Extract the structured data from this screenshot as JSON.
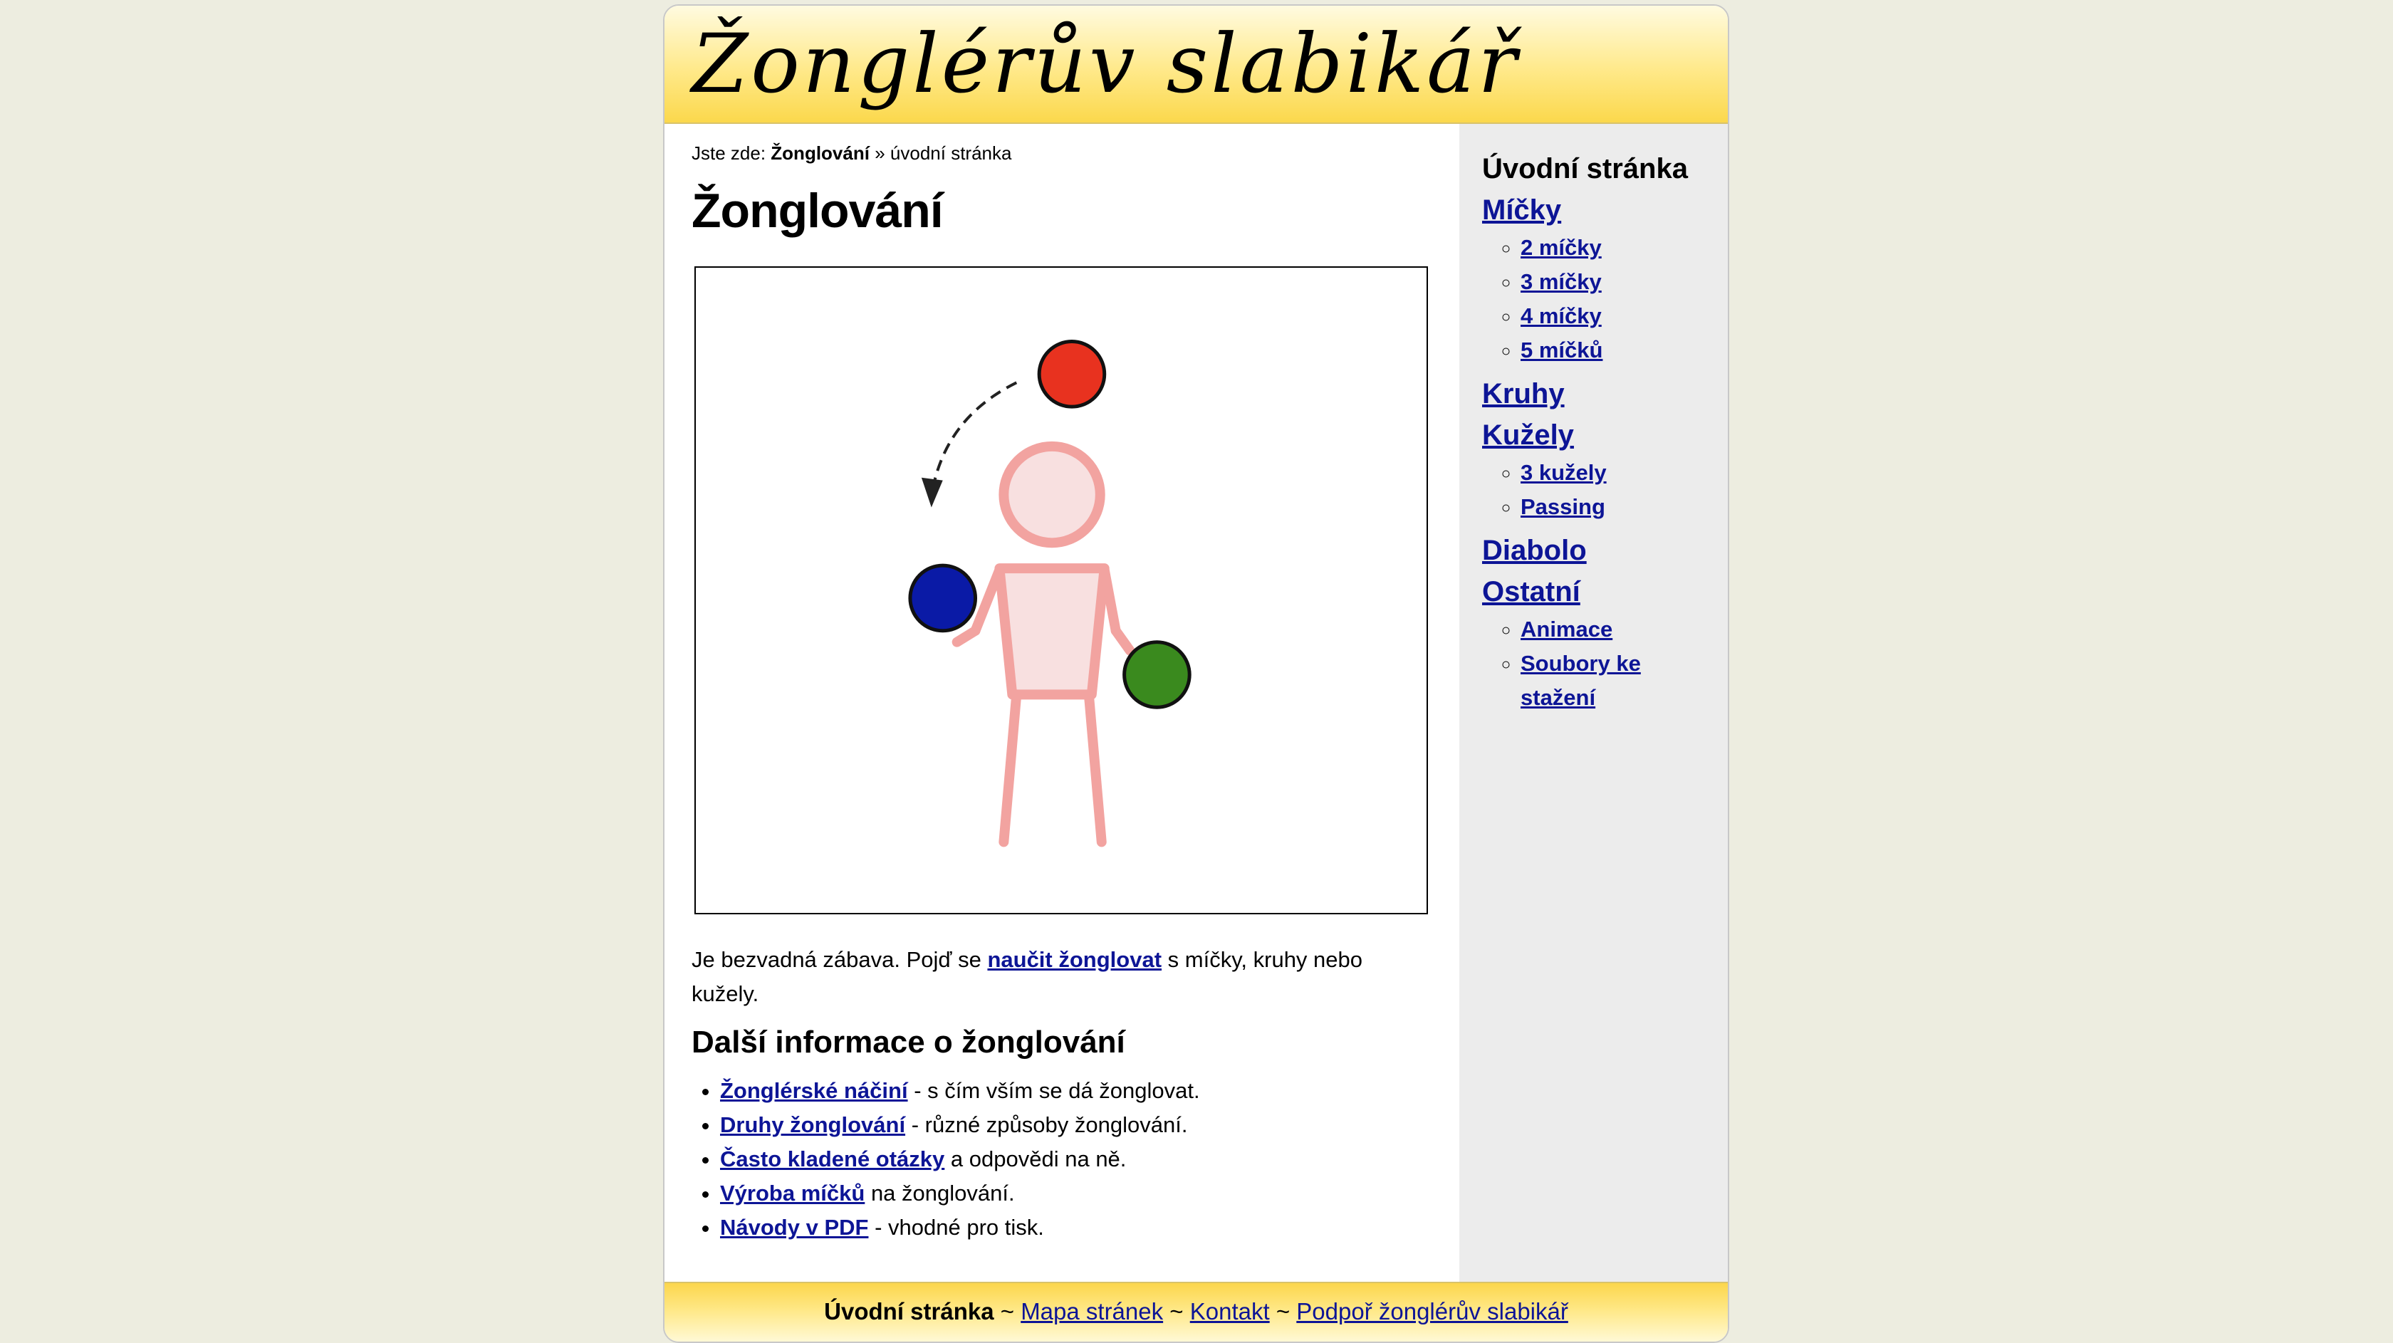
{
  "header": {
    "site_title": "Žonglérův slabikář"
  },
  "breadcrumb": {
    "prefix": "Jste zde:",
    "current_section": "Žonglování",
    "separator": "»",
    "page": "úvodní stránka"
  },
  "main": {
    "title": "Žonglování",
    "intro_before": "Je bezvadná zábava. Pojď se",
    "intro_link": "naučit žonglovat",
    "intro_after": "s míčky, kruhy nebo kužely.",
    "section_title": "Další informace o žonglování",
    "info_items": [
      {
        "link": "Žonglérské náčiní",
        "text": "- s čím vším se dá žonglovat."
      },
      {
        "link": "Druhy žonglování",
        "text": "- různé způsoby žonglování."
      },
      {
        "link": "Často kladené otázky",
        "text": "a odpovědi na ně."
      },
      {
        "link": "Výroba míčků",
        "text": "na žonglování."
      },
      {
        "link": "Návody v PDF",
        "text": "- vhodné pro tisk."
      }
    ]
  },
  "illustration": {
    "ball_colors": {
      "top": "#e8321f",
      "left": "#0a1aa6",
      "right": "#3a8a1e"
    },
    "figure_color": "#f2a3a0",
    "figure_fill": "#f8e0e0"
  },
  "sidebar": {
    "heading": "Úvodní stránka",
    "sections": [
      {
        "label": "Míčky",
        "items": [
          "2 míčky",
          "3 míčky",
          "4 míčky",
          "5 míčků"
        ]
      },
      {
        "label": "Kruhy",
        "items": []
      },
      {
        "label": "Kužely",
        "items": [
          "3 kužely",
          "Passing"
        ]
      },
      {
        "label": "Diabolo",
        "items": []
      },
      {
        "label": "Ostatní",
        "items": [
          "Animace",
          "Soubory ke stažení"
        ]
      }
    ]
  },
  "footer": {
    "home": "Úvodní stránka",
    "sep": "~",
    "links": [
      "Mapa stránek",
      "Kontakt",
      "Podpoř žonglérův slabikář"
    ]
  }
}
